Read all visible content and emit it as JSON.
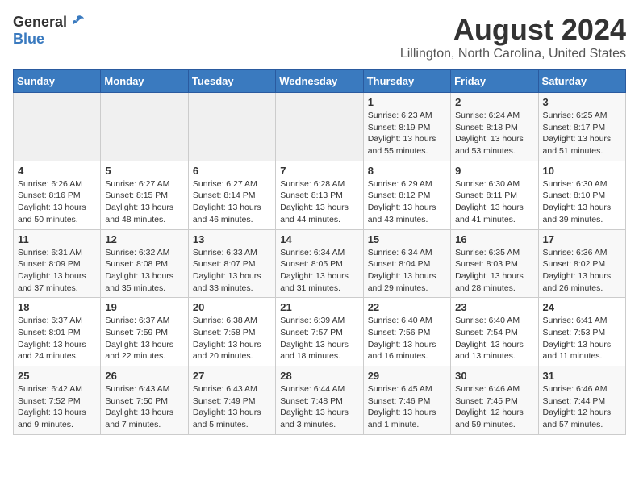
{
  "logo": {
    "general": "General",
    "blue": "Blue"
  },
  "title": "August 2024",
  "subtitle": "Lillington, North Carolina, United States",
  "weekdays": [
    "Sunday",
    "Monday",
    "Tuesday",
    "Wednesday",
    "Thursday",
    "Friday",
    "Saturday"
  ],
  "weeks": [
    [
      {
        "day": "",
        "info": ""
      },
      {
        "day": "",
        "info": ""
      },
      {
        "day": "",
        "info": ""
      },
      {
        "day": "",
        "info": ""
      },
      {
        "day": "1",
        "info": "Sunrise: 6:23 AM\nSunset: 8:19 PM\nDaylight: 13 hours and 55 minutes."
      },
      {
        "day": "2",
        "info": "Sunrise: 6:24 AM\nSunset: 8:18 PM\nDaylight: 13 hours and 53 minutes."
      },
      {
        "day": "3",
        "info": "Sunrise: 6:25 AM\nSunset: 8:17 PM\nDaylight: 13 hours and 51 minutes."
      }
    ],
    [
      {
        "day": "4",
        "info": "Sunrise: 6:26 AM\nSunset: 8:16 PM\nDaylight: 13 hours and 50 minutes."
      },
      {
        "day": "5",
        "info": "Sunrise: 6:27 AM\nSunset: 8:15 PM\nDaylight: 13 hours and 48 minutes."
      },
      {
        "day": "6",
        "info": "Sunrise: 6:27 AM\nSunset: 8:14 PM\nDaylight: 13 hours and 46 minutes."
      },
      {
        "day": "7",
        "info": "Sunrise: 6:28 AM\nSunset: 8:13 PM\nDaylight: 13 hours and 44 minutes."
      },
      {
        "day": "8",
        "info": "Sunrise: 6:29 AM\nSunset: 8:12 PM\nDaylight: 13 hours and 43 minutes."
      },
      {
        "day": "9",
        "info": "Sunrise: 6:30 AM\nSunset: 8:11 PM\nDaylight: 13 hours and 41 minutes."
      },
      {
        "day": "10",
        "info": "Sunrise: 6:30 AM\nSunset: 8:10 PM\nDaylight: 13 hours and 39 minutes."
      }
    ],
    [
      {
        "day": "11",
        "info": "Sunrise: 6:31 AM\nSunset: 8:09 PM\nDaylight: 13 hours and 37 minutes."
      },
      {
        "day": "12",
        "info": "Sunrise: 6:32 AM\nSunset: 8:08 PM\nDaylight: 13 hours and 35 minutes."
      },
      {
        "day": "13",
        "info": "Sunrise: 6:33 AM\nSunset: 8:07 PM\nDaylight: 13 hours and 33 minutes."
      },
      {
        "day": "14",
        "info": "Sunrise: 6:34 AM\nSunset: 8:05 PM\nDaylight: 13 hours and 31 minutes."
      },
      {
        "day": "15",
        "info": "Sunrise: 6:34 AM\nSunset: 8:04 PM\nDaylight: 13 hours and 29 minutes."
      },
      {
        "day": "16",
        "info": "Sunrise: 6:35 AM\nSunset: 8:03 PM\nDaylight: 13 hours and 28 minutes."
      },
      {
        "day": "17",
        "info": "Sunrise: 6:36 AM\nSunset: 8:02 PM\nDaylight: 13 hours and 26 minutes."
      }
    ],
    [
      {
        "day": "18",
        "info": "Sunrise: 6:37 AM\nSunset: 8:01 PM\nDaylight: 13 hours and 24 minutes."
      },
      {
        "day": "19",
        "info": "Sunrise: 6:37 AM\nSunset: 7:59 PM\nDaylight: 13 hours and 22 minutes."
      },
      {
        "day": "20",
        "info": "Sunrise: 6:38 AM\nSunset: 7:58 PM\nDaylight: 13 hours and 20 minutes."
      },
      {
        "day": "21",
        "info": "Sunrise: 6:39 AM\nSunset: 7:57 PM\nDaylight: 13 hours and 18 minutes."
      },
      {
        "day": "22",
        "info": "Sunrise: 6:40 AM\nSunset: 7:56 PM\nDaylight: 13 hours and 16 minutes."
      },
      {
        "day": "23",
        "info": "Sunrise: 6:40 AM\nSunset: 7:54 PM\nDaylight: 13 hours and 13 minutes."
      },
      {
        "day": "24",
        "info": "Sunrise: 6:41 AM\nSunset: 7:53 PM\nDaylight: 13 hours and 11 minutes."
      }
    ],
    [
      {
        "day": "25",
        "info": "Sunrise: 6:42 AM\nSunset: 7:52 PM\nDaylight: 13 hours and 9 minutes."
      },
      {
        "day": "26",
        "info": "Sunrise: 6:43 AM\nSunset: 7:50 PM\nDaylight: 13 hours and 7 minutes."
      },
      {
        "day": "27",
        "info": "Sunrise: 6:43 AM\nSunset: 7:49 PM\nDaylight: 13 hours and 5 minutes."
      },
      {
        "day": "28",
        "info": "Sunrise: 6:44 AM\nSunset: 7:48 PM\nDaylight: 13 hours and 3 minutes."
      },
      {
        "day": "29",
        "info": "Sunrise: 6:45 AM\nSunset: 7:46 PM\nDaylight: 13 hours and 1 minute."
      },
      {
        "day": "30",
        "info": "Sunrise: 6:46 AM\nSunset: 7:45 PM\nDaylight: 12 hours and 59 minutes."
      },
      {
        "day": "31",
        "info": "Sunrise: 6:46 AM\nSunset: 7:44 PM\nDaylight: 12 hours and 57 minutes."
      }
    ]
  ]
}
